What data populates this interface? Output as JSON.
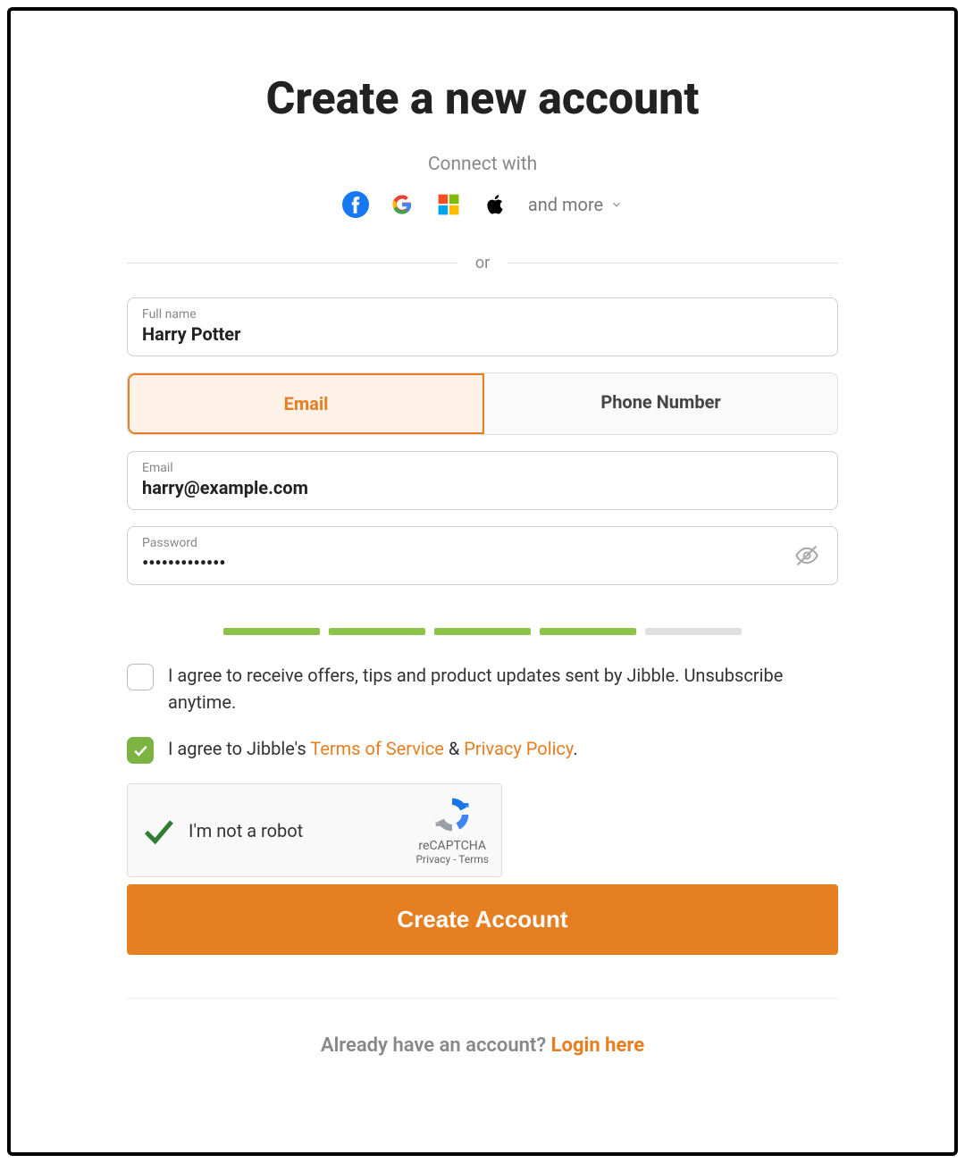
{
  "title": "Create a new account",
  "connect_label": "Connect with",
  "social": {
    "more_label": "and more"
  },
  "divider_or": "or",
  "fields": {
    "full_name_label": "Full name",
    "full_name_value": "Harry Potter",
    "email_label": "Email",
    "email_value": "harry@example.com",
    "password_label": "Password",
    "password_value": "•••••••••••••"
  },
  "tabs": {
    "email": "Email",
    "phone": "Phone Number"
  },
  "strength": {
    "filled": 4,
    "total": 5
  },
  "consent1": "I agree to receive offers, tips and product updates sent by Jibble. Unsubscribe anytime.",
  "consent2_prefix": "I agree to Jibble's ",
  "consent2_tos": "Terms of Service",
  "consent2_amp": " & ",
  "consent2_privacy": "Privacy Policy",
  "consent2_suffix": ".",
  "recaptcha": {
    "label": "I'm not a robot",
    "brand": "reCAPTCHA",
    "links": "Privacy - Terms"
  },
  "submit_label": "Create Account",
  "footer": {
    "prefix": "Already have an account? ",
    "login": "Login here"
  }
}
